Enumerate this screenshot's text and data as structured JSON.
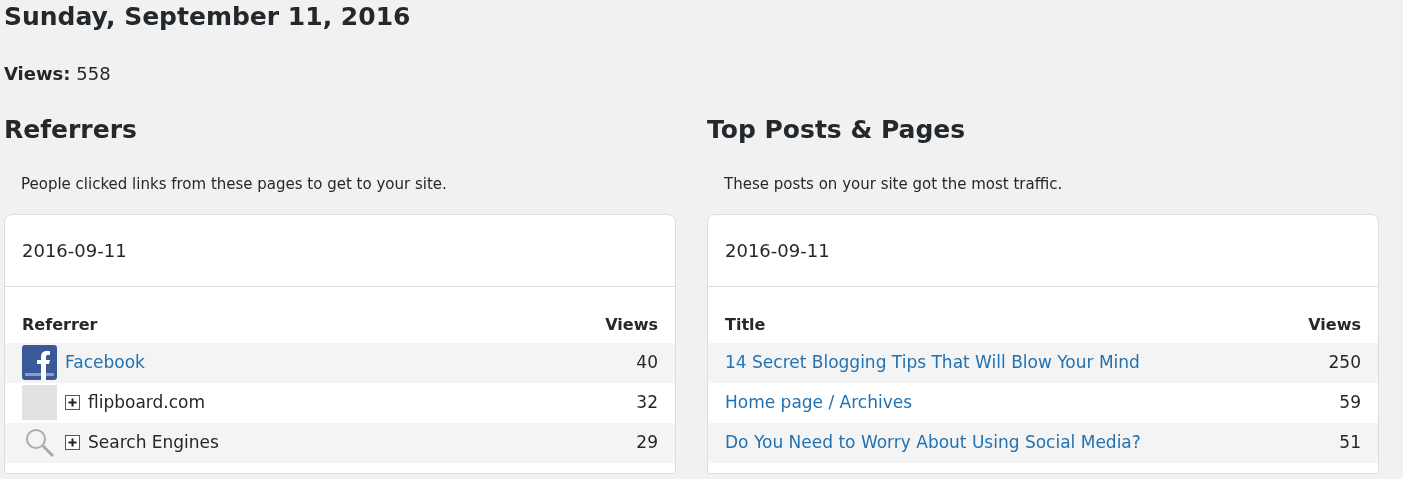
{
  "day_title": "Sunday, September 11, 2016",
  "views": {
    "label": "Views:",
    "value": "558"
  },
  "panels": [
    {
      "heading": "Referrers",
      "description": "People clicked links from these pages to get to your site.",
      "date": "2016-09-11",
      "columns": [
        "Referrer",
        "Views"
      ],
      "rows": [
        {
          "kind": "social",
          "label": "Facebook",
          "views": "40"
        },
        {
          "kind": "site",
          "label": "flipboard.com",
          "views": "32"
        },
        {
          "kind": "search",
          "label": "Search Engines",
          "views": "29"
        }
      ]
    },
    {
      "heading": "Top Posts & Pages",
      "description": "These posts on your site got the most traffic.",
      "date": "2016-09-11",
      "columns": [
        "Title",
        "Views"
      ],
      "rows": [
        {
          "kind": "link",
          "label": "14 Secret Blogging Tips That Will Blow Your Mind",
          "views": "250"
        },
        {
          "kind": "link",
          "label": "Home page / Archives",
          "views": "59"
        },
        {
          "kind": "link",
          "label": "Do You Need to Worry About Using Social Media?",
          "views": "51"
        }
      ]
    }
  ]
}
